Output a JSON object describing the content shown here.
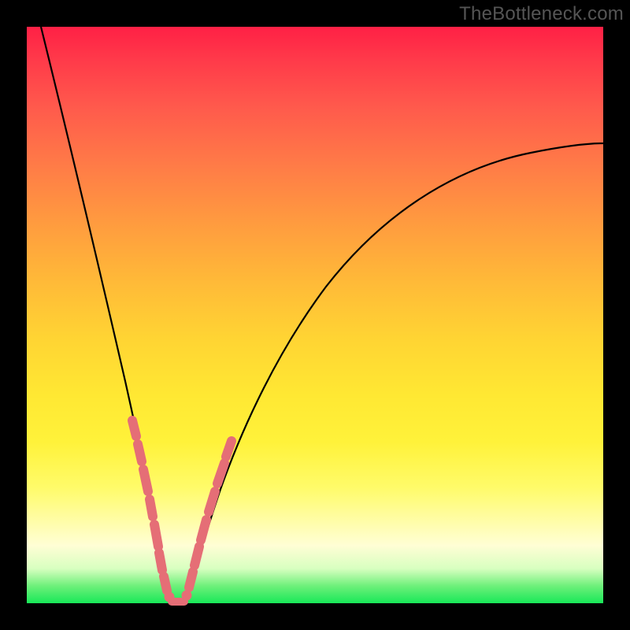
{
  "watermark": "TheBottleneck.com",
  "colors": {
    "background": "#000000",
    "curve": "#000000",
    "beads": "#e56e76"
  },
  "chart_data": {
    "type": "line",
    "title": "",
    "xlabel": "",
    "ylabel": "",
    "xlim": [
      0,
      100
    ],
    "ylim": [
      0,
      100
    ],
    "series": [
      {
        "name": "left-branch",
        "x": [
          2,
          4,
          6,
          8,
          10,
          12,
          14,
          16,
          18,
          19,
          20,
          21,
          22,
          23,
          24
        ],
        "y": [
          100,
          89,
          78,
          67,
          57,
          47,
          38,
          30,
          22,
          18,
          14,
          10,
          6,
          3,
          0
        ]
      },
      {
        "name": "right-branch",
        "x": [
          27,
          28,
          30,
          33,
          37,
          42,
          48,
          55,
          63,
          72,
          82,
          92,
          100
        ],
        "y": [
          0,
          4,
          10,
          18,
          28,
          38,
          47,
          55,
          62,
          68,
          73,
          77,
          80
        ]
      }
    ],
    "annotations": [
      {
        "name": "bead-cluster-left",
        "x_range": [
          16,
          23
        ],
        "y_range": [
          2,
          30
        ]
      },
      {
        "name": "bead-cluster-right",
        "x_range": [
          27,
          33
        ],
        "y_range": [
          2,
          22
        ]
      },
      {
        "name": "bead-cluster-bottom",
        "x_range": [
          23,
          27
        ],
        "y_range": [
          0,
          2
        ]
      }
    ]
  }
}
